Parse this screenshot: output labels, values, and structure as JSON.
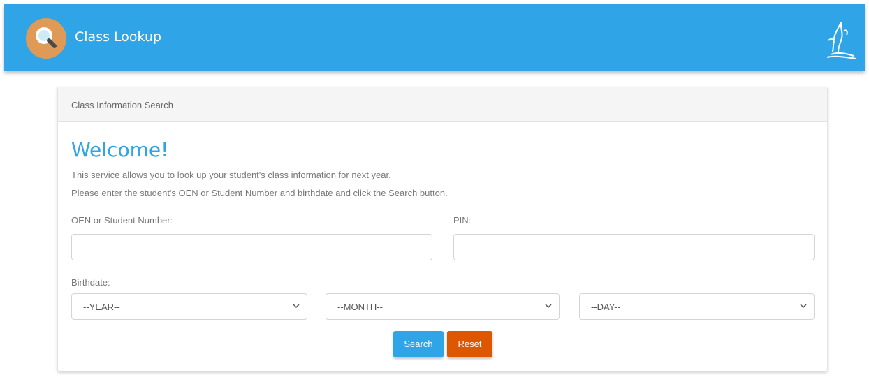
{
  "header": {
    "title": "Class Lookup",
    "icon": "search-icon",
    "brand_icon": "board-logo-icon",
    "background": "#2fa4e7",
    "logo_circle_color": "#e09a57"
  },
  "panel": {
    "heading": "Class Information Search",
    "welcome": "Welcome!",
    "intro_line1": "This service allows you to look up your student's class information for next year.",
    "intro_line2": "Please enter the student's OEN or Student Number and birthdate and click the Search button."
  },
  "form": {
    "oen_label": "OEN or Student Number:",
    "oen_value": "",
    "pin_label": "PIN:",
    "pin_value": "",
    "birthdate_label": "Birthdate:",
    "year_selected": "--YEAR--",
    "month_selected": "--MONTH--",
    "day_selected": "--DAY--",
    "search_label": "Search",
    "reset_label": "Reset"
  },
  "colors": {
    "accent": "#2fa4e7",
    "reset": "#dd5600"
  }
}
